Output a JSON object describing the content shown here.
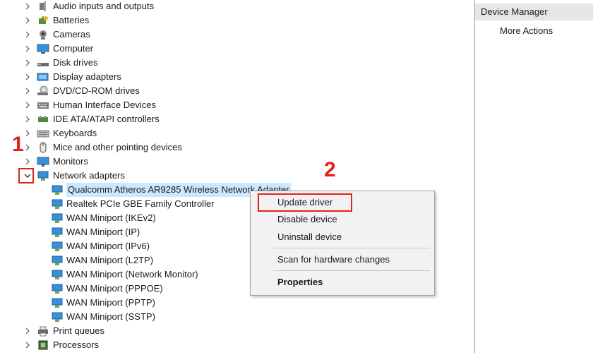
{
  "tree": {
    "categories_top": [
      {
        "label": "Audio inputs and outputs",
        "icon": "speaker-icon"
      },
      {
        "label": "Batteries",
        "icon": "battery-icon"
      },
      {
        "label": "Cameras",
        "icon": "camera-icon"
      },
      {
        "label": "Computer",
        "icon": "computer-icon"
      },
      {
        "label": "Disk drives",
        "icon": "disk-drive-icon"
      },
      {
        "label": "Display adapters",
        "icon": "display-adapter-icon"
      },
      {
        "label": "DVD/CD-ROM drives",
        "icon": "dvd-drive-icon"
      },
      {
        "label": "Human Interface Devices",
        "icon": "hid-icon"
      },
      {
        "label": "IDE ATA/ATAPI controllers",
        "icon": "ide-controller-icon"
      },
      {
        "label": "Keyboards",
        "icon": "keyboard-icon"
      },
      {
        "label": "Mice and other pointing devices",
        "icon": "mouse-icon"
      },
      {
        "label": "Monitors",
        "icon": "monitor-icon"
      }
    ],
    "expanded_category": {
      "label": "Network adapters",
      "icon": "network-adapter-icon"
    },
    "network_adapters": [
      "Qualcomm Atheros AR9285 Wireless Network Adapter",
      "Realtek PCIe GBE Family Controller",
      "WAN Miniport (IKEv2)",
      "WAN Miniport (IP)",
      "WAN Miniport (IPv6)",
      "WAN Miniport (L2TP)",
      "WAN Miniport (Network Monitor)",
      "WAN Miniport (PPPOE)",
      "WAN Miniport (PPTP)",
      "WAN Miniport (SSTP)"
    ],
    "categories_bottom": [
      {
        "label": "Print queues",
        "icon": "printer-icon"
      },
      {
        "label": "Processors",
        "icon": "processor-icon"
      }
    ]
  },
  "context_menu": {
    "update_driver": "Update driver",
    "disable_device": "Disable device",
    "uninstall_device": "Uninstall device",
    "scan_hardware": "Scan for hardware changes",
    "properties": "Properties"
  },
  "actions_pane": {
    "header": "Device Manager",
    "more_actions": "More Actions"
  },
  "annotations": {
    "step1": "1",
    "step2": "2"
  },
  "colors": {
    "annotation_red": "#e2231a",
    "selection_blue": "#cce8ff",
    "menu_bg": "#f2f2f2"
  }
}
